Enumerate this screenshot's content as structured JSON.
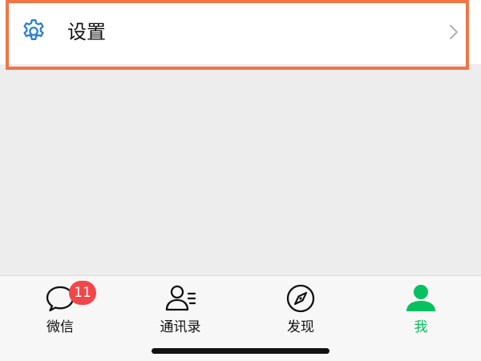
{
  "settings": {
    "label": "设置",
    "icon": "gear-icon",
    "chevron_icon": "chevron-right-icon"
  },
  "tabbar": {
    "tabs": [
      {
        "label": "微信",
        "icon": "chat-bubble-icon",
        "badge": "11",
        "active": false
      },
      {
        "label": "通讯录",
        "icon": "contacts-icon",
        "active": false
      },
      {
        "label": "发现",
        "icon": "compass-icon",
        "active": true
      },
      {
        "label": "我",
        "icon": "person-icon",
        "active": true
      }
    ]
  },
  "colors": {
    "accent_green": "#07c160",
    "highlight_border": "#f07647",
    "badge_red": "#f3464a",
    "icon_blue": "#2a7fd4"
  }
}
